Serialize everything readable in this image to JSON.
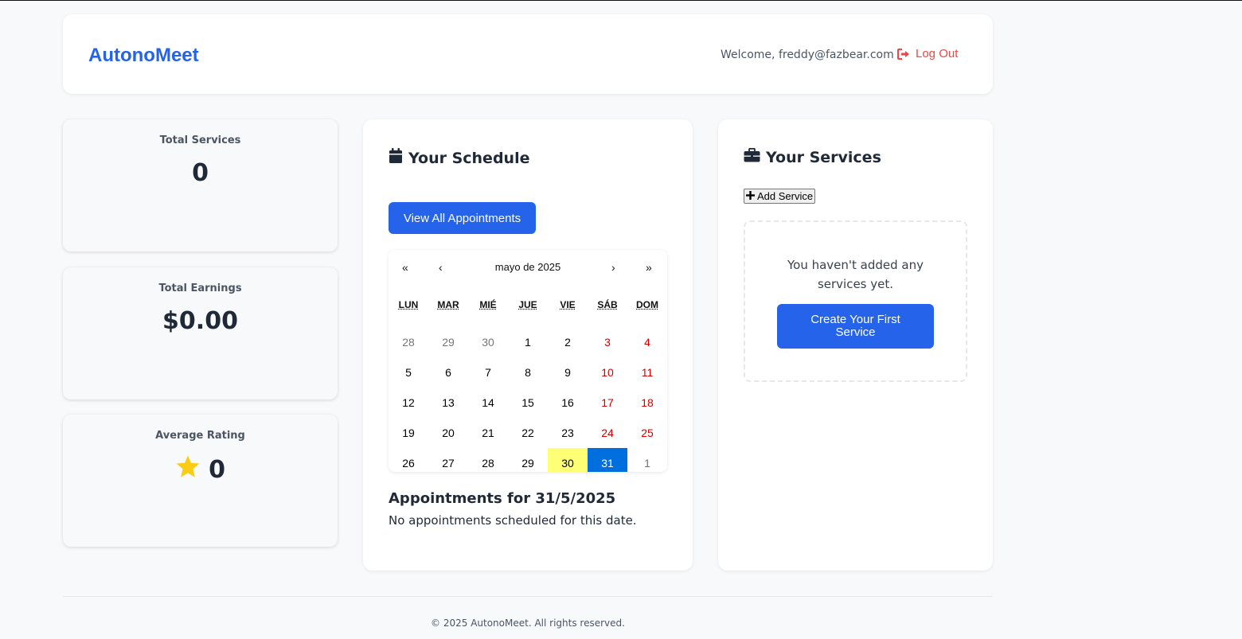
{
  "header": {
    "brand": "AutonoMeet",
    "welcome": "Welcome, freddy@fazbear.com",
    "logout_label": "Log Out"
  },
  "stats": [
    {
      "label": "Total Services",
      "value": "0"
    },
    {
      "label": "Total Earnings",
      "value": "$0.00"
    },
    {
      "label": "Average Rating",
      "value": "0"
    }
  ],
  "schedule": {
    "title": "Your Schedule",
    "view_all_label": "View All Appointments",
    "calendar": {
      "nav_prev2": "«",
      "nav_prev": "‹",
      "month_label": "mayo de 2025",
      "nav_next": "›",
      "nav_next2": "»",
      "weekdays": [
        "LUN",
        "MAR",
        "MIÉ",
        "JUE",
        "VIE",
        "SÁB",
        "DOM"
      ],
      "days": [
        "28",
        "29",
        "30",
        "1",
        "2",
        "3",
        "4",
        "5",
        "6",
        "7",
        "8",
        "9",
        "10",
        "11",
        "12",
        "13",
        "14",
        "15",
        "16",
        "17",
        "18",
        "19",
        "20",
        "21",
        "22",
        "23",
        "24",
        "25",
        "26",
        "27",
        "28",
        "29",
        "30",
        "31",
        "1"
      ],
      "today": "30",
      "selected": "31"
    },
    "appointments_title": "Appointments for 31/5/2025",
    "appointments_empty": "No appointments scheduled for this date."
  },
  "services": {
    "title": "Your Services",
    "add_label": "Add Service",
    "empty_text": "You haven't added any services yet.",
    "create_first_label": "Create Your First Service"
  },
  "footer": {
    "text": "© 2025 AutonoMeet. All rights reserved."
  },
  "colors": {
    "accent": "#2563eb",
    "danger": "#ef4444",
    "star": "#facc15",
    "today_highlight": "#ffff76",
    "selected_day": "#006edc"
  }
}
